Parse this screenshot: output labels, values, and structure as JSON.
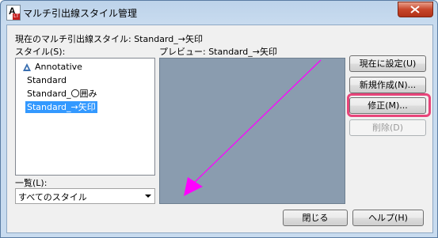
{
  "window": {
    "title": "マルチ引出線スタイル管理"
  },
  "current_style": {
    "label": "現在のマルチ引出線スタイル: Standard_→矢印"
  },
  "styles": {
    "label": "スタイル(S):",
    "items": [
      {
        "label": "Annotative",
        "icon": "annotative-icon"
      },
      {
        "label": "Standard"
      },
      {
        "label": "Standard_〇囲み"
      },
      {
        "label": "Standard_→矢印",
        "selected": true
      }
    ]
  },
  "preview": {
    "label": "プレビュー: Standard_→矢印",
    "leader_color": "#ff00ff",
    "background": "#8a9caf"
  },
  "filter": {
    "label": "一覧(L):",
    "value": "すべてのスタイル"
  },
  "buttons": {
    "set_current": "現在に設定(U)",
    "new": "新規作成(N)...",
    "modify": "修正(M)...",
    "delete": "削除(D)",
    "close": "閉じる",
    "help": "ヘルプ(H)"
  },
  "highlight_color": "#e8447a"
}
